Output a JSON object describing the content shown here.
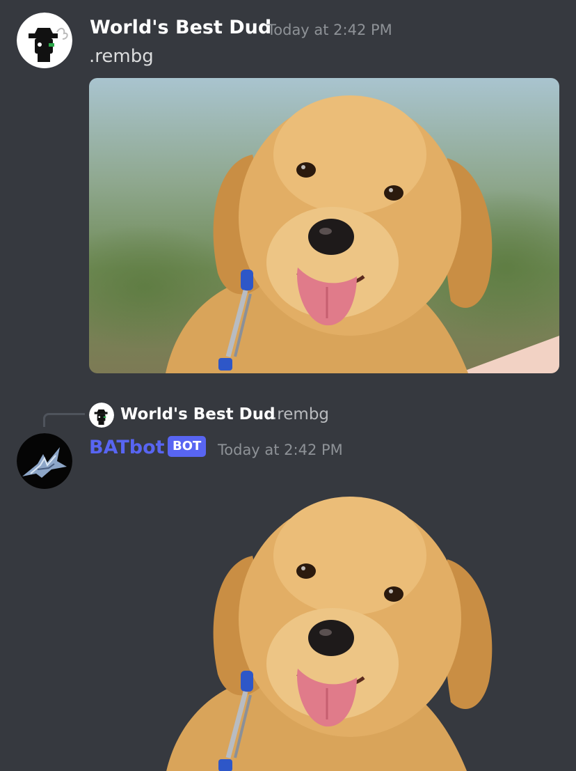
{
  "messages": [
    {
      "author": "World's Best Dud",
      "timestamp": "Today at 2:42 PM",
      "content": ".rembg",
      "avatar_icon": "user-avatar-icon",
      "attachment": "puppy-photo"
    },
    {
      "reply": {
        "author": "World's Best Dud",
        "content": ".rembg"
      },
      "author": "BATbot",
      "author_color": "#5865f2",
      "badge": "BOT",
      "timestamp": "Today at 2:42 PM",
      "avatar_icon": "bat-avatar-icon",
      "attachment": "puppy-photo-background-removed"
    }
  ],
  "colors": {
    "background": "#36393f",
    "username": "#ffffff",
    "bot_name": "#5865f2",
    "bot_badge": "#5865f2",
    "timestamp": "#8e9297",
    "text": "#dcddde"
  }
}
